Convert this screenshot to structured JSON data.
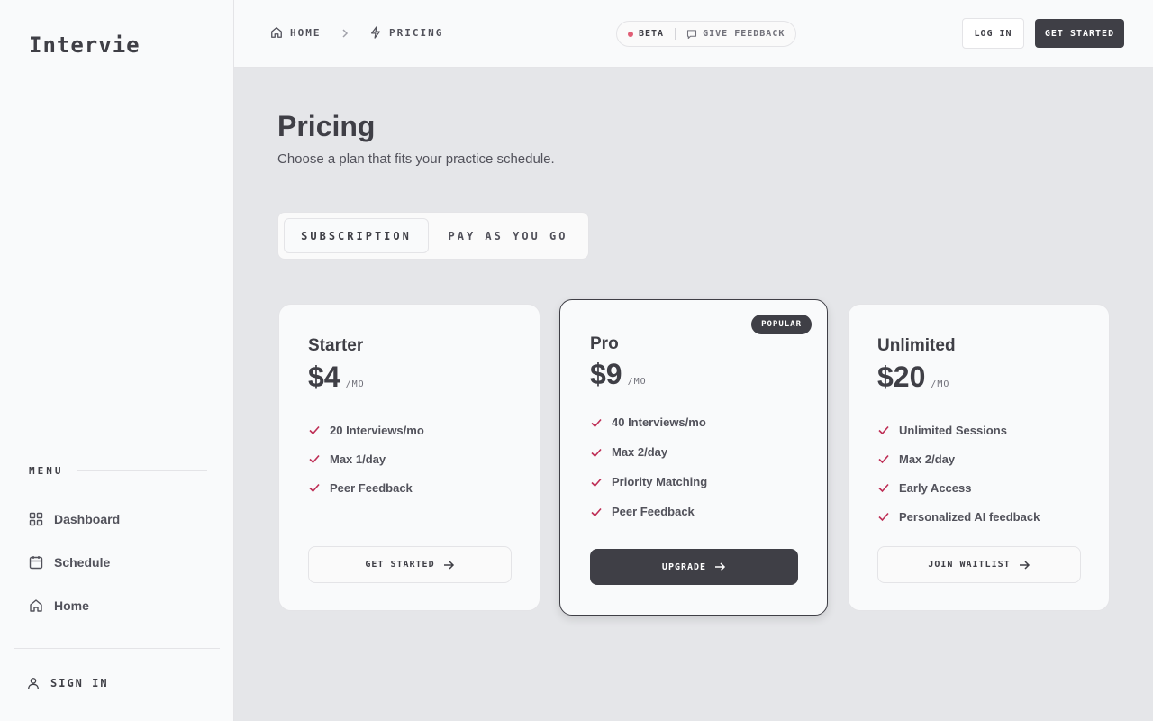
{
  "app": {
    "logo": "Intervie"
  },
  "sidebar": {
    "menu_heading": "MENU",
    "items": [
      {
        "label": "Dashboard",
        "icon": "grid-icon"
      },
      {
        "label": "Schedule",
        "icon": "calendar-icon"
      },
      {
        "label": "Home",
        "icon": "home-icon"
      }
    ],
    "sign_in": "SIGN IN"
  },
  "topbar": {
    "breadcrumb": [
      {
        "label": "HOME",
        "icon": "home-icon"
      },
      {
        "label": "PRICING",
        "icon": "bolt-icon"
      }
    ],
    "beta_label": "BETA",
    "feedback_label": "GIVE FEEDBACK",
    "login_label": "LOG IN",
    "get_started_label": "GET STARTED"
  },
  "page": {
    "title": "Pricing",
    "subtitle": "Choose a plan that fits your practice schedule.",
    "tabs": [
      {
        "label": "SUBSCRIPTION",
        "active": true
      },
      {
        "label": "PAY AS YOU GO",
        "active": false
      }
    ]
  },
  "plans": [
    {
      "name": "Starter",
      "price": "$4",
      "period": "/MO",
      "features": [
        "20 Interviews/mo",
        "Max 1/day",
        "Peer Feedback"
      ],
      "cta": "GET STARTED"
    },
    {
      "name": "Pro",
      "price": "$9",
      "period": "/MO",
      "badge": "POPULAR",
      "features": [
        "40 Interviews/mo",
        "Max 2/day",
        "Priority Matching",
        "Peer Feedback"
      ],
      "cta": "UPGRADE"
    },
    {
      "name": "Unlimited",
      "price": "$20",
      "period": "/MO",
      "features": [
        "Unlimited Sessions",
        "Max 2/day",
        "Early Access",
        "Personalized AI feedback"
      ],
      "cta": "JOIN WAITLIST"
    }
  ],
  "colors": {
    "accent_dark": "#3f3f46",
    "check": "#be2d55",
    "beta_dot": "#e05d75",
    "background": "#e5e6e9",
    "surface": "#f9fafb"
  }
}
